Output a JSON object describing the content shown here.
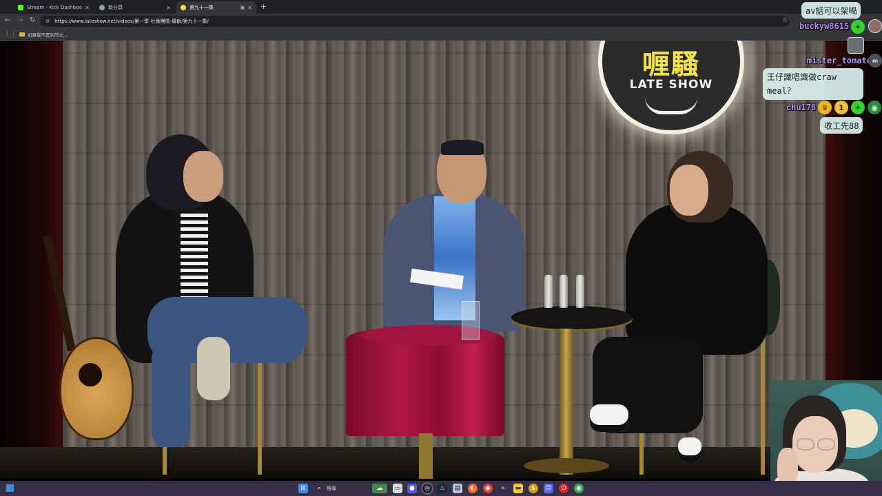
{
  "browser": {
    "tabs": [
      {
        "title": "Stream - Kick Dashboard",
        "favicon_color": "#53fc18",
        "active": false
      },
      {
        "title": "新分頁",
        "favicon_color": "#9aa0a6",
        "active": false
      },
      {
        "title": "第九十一集",
        "favicon_color": "#f3e24a",
        "active": true
      }
    ],
    "new_tab_icon": "+",
    "url": "https://www.lateshow.net/videos/第一季-杜薇團情-最新/第九十一集/",
    "bookmark_label": "如果我不是別的文...",
    "icons": [
      "back-icon",
      "forward-icon",
      "reload-icon",
      "site-info-icon",
      "star-icon",
      "apps-icon"
    ]
  },
  "video": {
    "logo_title": "喱騷",
    "logo_subtitle": "LATE SHOW"
  },
  "chat": {
    "messages": [
      {
        "user": "buckyw8615",
        "user_color": "#b48cff",
        "text": "av話可以架喎",
        "badges": [
          "star-badge"
        ]
      },
      {
        "user": "mister_tomato",
        "user_color": "#b9a2ff",
        "text": "王仔識唔識做craw meal？",
        "badges": [
          "mod-badge"
        ]
      },
      {
        "user": "chu178",
        "user_color": "#b48cff",
        "text": "收工先88",
        "badges": [
          "crown-badge",
          "rank-badge",
          "star-badge",
          "globe-badge"
        ]
      }
    ],
    "rank_badge_text": "1",
    "mod_badge_text": "m"
  },
  "taskbar": {
    "search_label": "搜尋",
    "icons": [
      "start-icon",
      "search-icon",
      "widgets-icon",
      "file-explorer-icon",
      "chat-icon",
      "obs-icon",
      "steam-icon",
      "screen-icon",
      "firefox-icon",
      "chrome-icon",
      "arrow-icon",
      "folder-icon",
      "coin-icon",
      "discord-icon",
      "opera-icon",
      "chrome-alt-icon"
    ]
  },
  "colors": {
    "kick_green": "#53fc18",
    "taskbar_bg": "#362f45",
    "chat_bubble": "#d6ecec",
    "logo_yellow": "#f3e24a"
  }
}
